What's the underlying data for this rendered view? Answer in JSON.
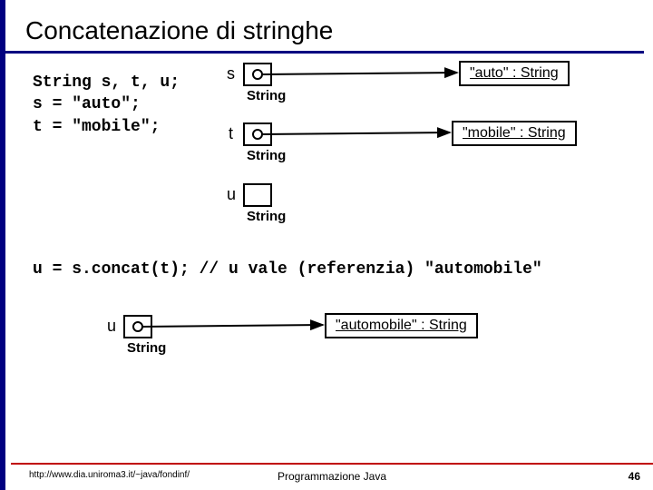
{
  "title": "Concatenazione di stringhe",
  "code_block": "String s, t, u;\ns = \"auto\";\nt = \"mobile\";",
  "vars": {
    "s": {
      "label": "s",
      "type": "String",
      "obj": "\"auto\" : String"
    },
    "t": {
      "label": "t",
      "type": "String",
      "obj": "\"mobile\" : String"
    },
    "u_top": {
      "label": "u",
      "type": "String"
    }
  },
  "code_line2": "u = s.concat(t); // u vale (referenzia) \"automobile\"",
  "u_bottom": {
    "label": "u",
    "type": "String",
    "obj": "\"automobile\" : String"
  },
  "footer": {
    "left": "http://www.dia.uniroma3.it/~java/fondinf/",
    "center": "Programmazione Java",
    "page": "46"
  }
}
